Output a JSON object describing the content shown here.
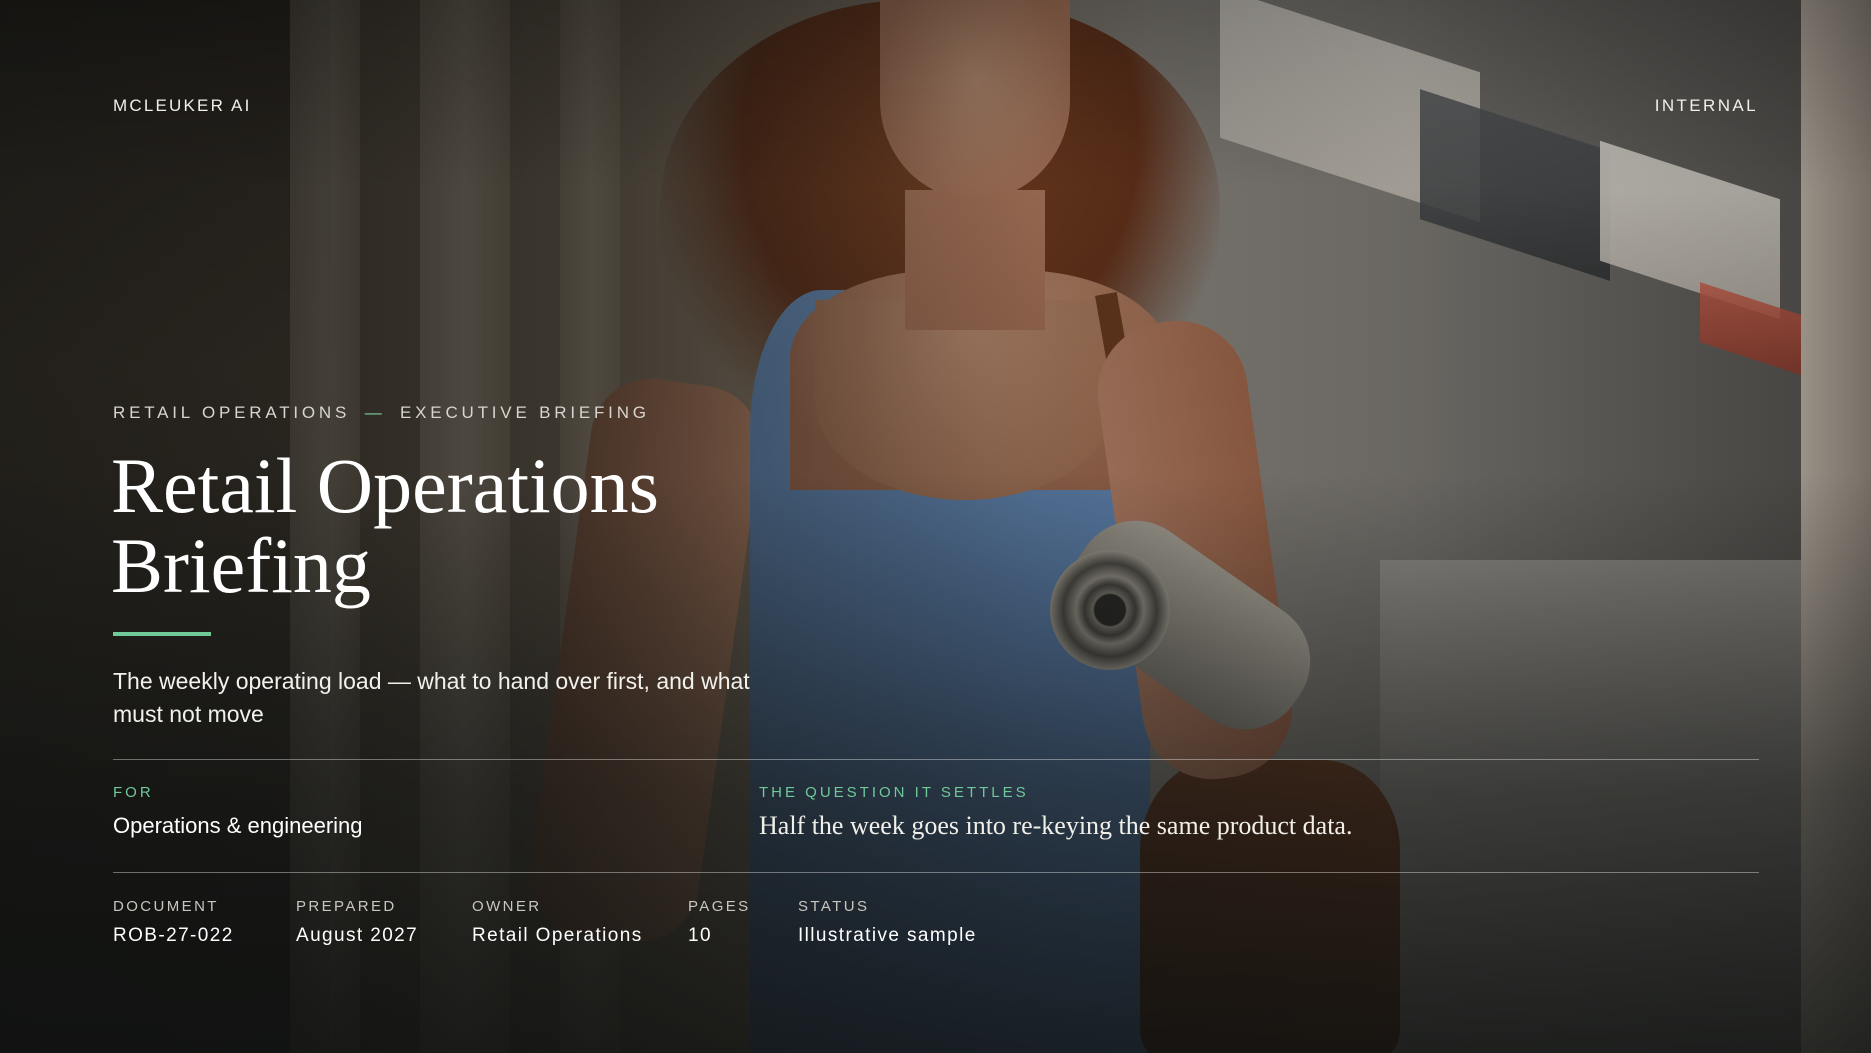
{
  "header": {
    "brand": "MCLEUKER AI",
    "classification": "INTERNAL"
  },
  "hero": {
    "eyebrow_left": "RETAIL OPERATIONS",
    "eyebrow_dash": "—",
    "eyebrow_right": "EXECUTIVE BRIEFING",
    "title_line1": "Retail Operations",
    "title_line2": "Briefing",
    "subtitle": "The weekly operating load — what to hand over first, and what must not move"
  },
  "audience": {
    "label": "FOR",
    "value": "Operations & engineering"
  },
  "question": {
    "label": "THE QUESTION IT SETTLES",
    "value": "Half the week goes into re-keying the same product data."
  },
  "meta": [
    {
      "label": "DOCUMENT",
      "value": "ROB-27-022"
    },
    {
      "label": "PREPARED",
      "value": "August 2027"
    },
    {
      "label": "OWNER",
      "value": "Retail Operations"
    },
    {
      "label": "PAGES",
      "value": "10"
    },
    {
      "label": "STATUS",
      "value": "Illustrative sample"
    }
  ],
  "colors": {
    "accent": "#6fc998",
    "text": "#ffffff"
  }
}
